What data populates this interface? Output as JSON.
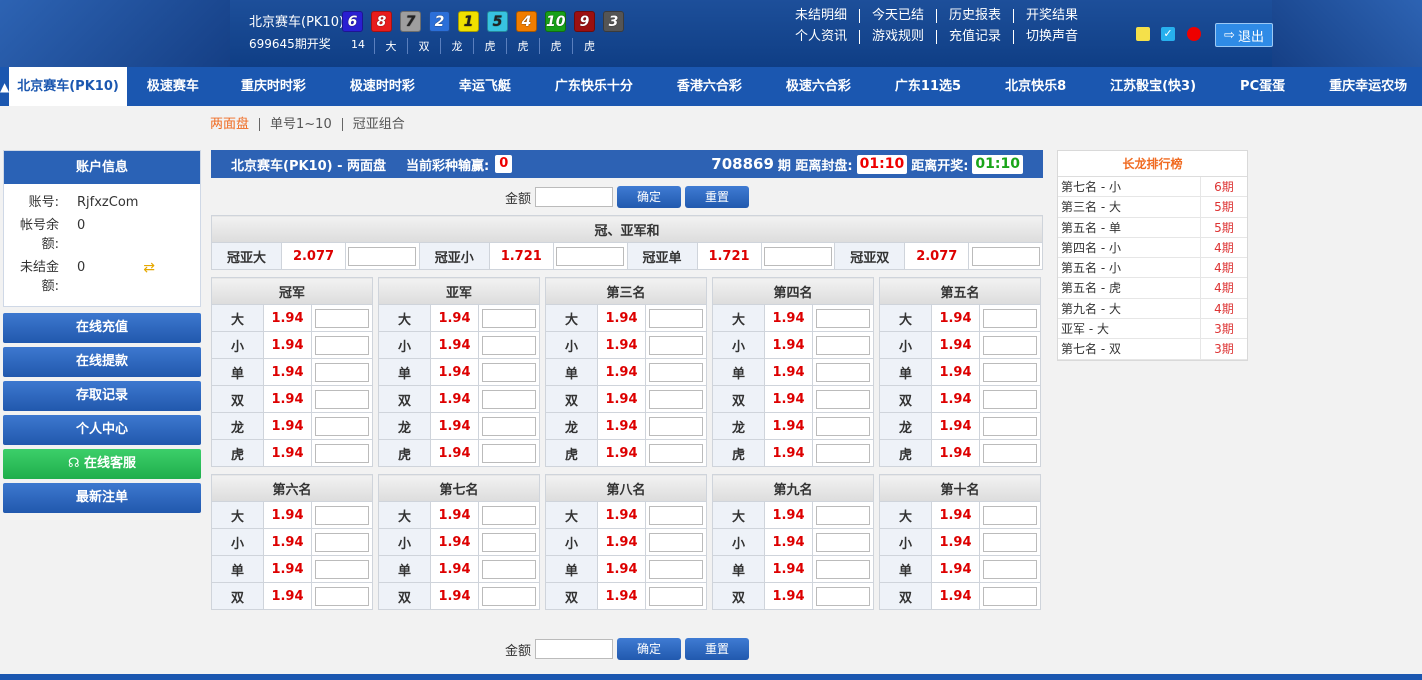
{
  "header": {
    "game_name": "北京赛车(PK10)",
    "period": "699645期开奖",
    "balls": [
      {
        "n": "6",
        "c": "#2a1fd1"
      },
      {
        "n": "8",
        "c": "#e81c1c"
      },
      {
        "n": "7",
        "c": "#9e9e9e"
      },
      {
        "n": "2",
        "c": "#2b6fd9"
      },
      {
        "n": "1",
        "c": "#f0e000"
      },
      {
        "n": "5",
        "c": "#37c3e0"
      },
      {
        "n": "4",
        "c": "#f07d00"
      },
      {
        "n": "10",
        "c": "#18a018"
      },
      {
        "n": "9",
        "c": "#9c1010"
      },
      {
        "n": "3",
        "c": "#555555"
      }
    ],
    "sums": [
      "14",
      "大",
      "双",
      "龙",
      "虎",
      "虎",
      "虎",
      "虎"
    ],
    "links_row1": [
      "未结明细",
      "今天已结",
      "历史报表",
      "开奖结果"
    ],
    "links_row2": [
      "个人资讯",
      "游戏规则",
      "充值记录",
      "切换声音"
    ],
    "logout": "退出"
  },
  "nav": {
    "tabs": [
      "北京赛车(PK10)",
      "极速赛车",
      "重庆时时彩",
      "极速时时彩",
      "幸运飞艇",
      "广东快乐十分",
      "香港六合彩",
      "极速六合彩",
      "广东11选5",
      "北京快乐8",
      "江苏骰宝(快3)",
      "PC蛋蛋",
      "重庆幸运农场"
    ]
  },
  "subnav": [
    "两面盘",
    "单号1~10",
    "冠亚组合"
  ],
  "account": {
    "title": "账户信息",
    "rows": [
      {
        "k": "账号:",
        "v": "RjfxzCom"
      },
      {
        "k": "帐号余额:",
        "v": "0"
      },
      {
        "k": "未结金额:",
        "v": "0"
      }
    ]
  },
  "side_buttons": [
    "在线充值",
    "在线提款",
    "存取记录",
    "个人中心",
    "在线客服",
    "最新注单"
  ],
  "bar": {
    "title": "北京赛车(PK10) - 两面盘",
    "win_label": "当前彩种输赢:",
    "win": "0",
    "period": "708869",
    "close_label": "期 距离封盘:",
    "close": "01:10",
    "open_label": "距离开奖:",
    "open": "01:10"
  },
  "amount": {
    "label": "金额",
    "confirm": "确定",
    "reset": "重置"
  },
  "sum_section": {
    "title": "冠、亚军和",
    "items": [
      {
        "l": "冠亚大",
        "o": "2.077"
      },
      {
        "l": "冠亚小",
        "o": "1.721"
      },
      {
        "l": "冠亚单",
        "o": "1.721"
      },
      {
        "l": "冠亚双",
        "o": "2.077"
      }
    ]
  },
  "groups1": [
    {
      "t": "冠军"
    },
    {
      "t": "亚军"
    },
    {
      "t": "第三名"
    },
    {
      "t": "第四名"
    },
    {
      "t": "第五名"
    }
  ],
  "groups2": [
    {
      "t": "第六名"
    },
    {
      "t": "第七名"
    },
    {
      "t": "第八名"
    },
    {
      "t": "第九名"
    },
    {
      "t": "第十名"
    }
  ],
  "bets6": [
    "大",
    "小",
    "单",
    "双",
    "龙",
    "虎"
  ],
  "bets4": [
    "大",
    "小",
    "单",
    "双"
  ],
  "odds": "1.94",
  "ranking": {
    "title": "长龙排行榜",
    "rows": [
      {
        "k": "第七名 - 小",
        "v": "6期"
      },
      {
        "k": "第三名 - 大",
        "v": "5期"
      },
      {
        "k": "第五名 - 单",
        "v": "5期"
      },
      {
        "k": "第四名 - 小",
        "v": "4期"
      },
      {
        "k": "第五名 - 小",
        "v": "4期"
      },
      {
        "k": "第五名 - 虎",
        "v": "4期"
      },
      {
        "k": "第九名 - 大",
        "v": "4期"
      },
      {
        "k": "亚军 - 大",
        "v": "3期"
      },
      {
        "k": "第七名 - 双",
        "v": "3期"
      }
    ]
  }
}
